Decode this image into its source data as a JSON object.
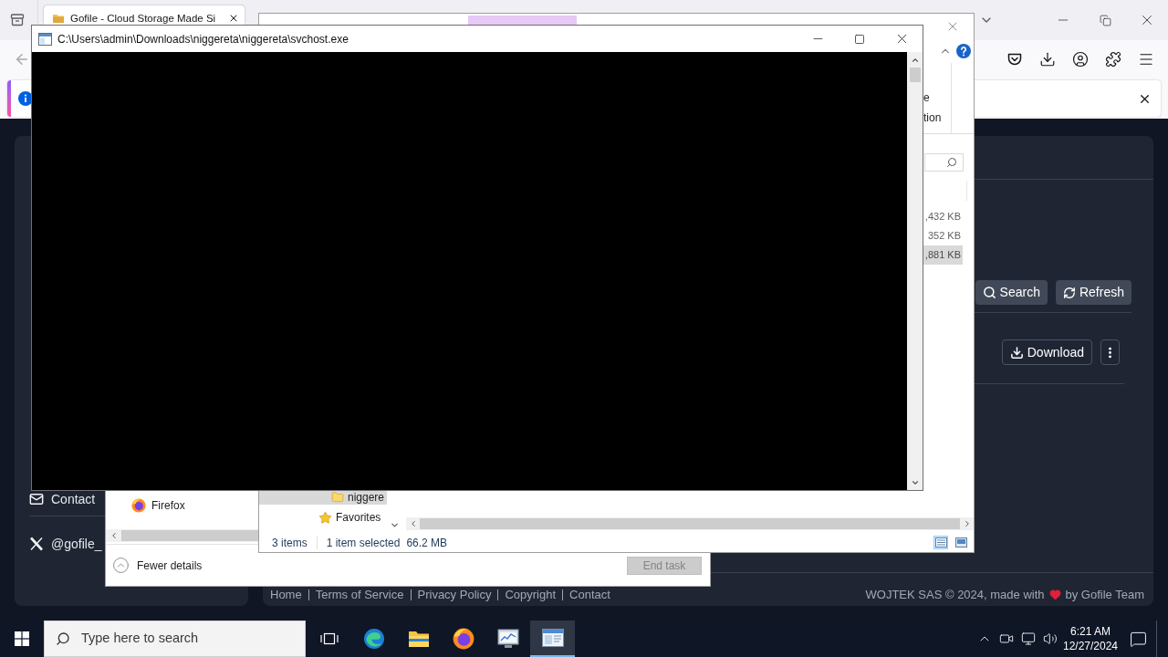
{
  "browser": {
    "tabs": [
      {
        "title": "Gofile - Cloud Storage Made Si",
        "selected": true
      }
    ]
  },
  "console": {
    "title": "C:\\Users\\admin\\Downloads\\niggereta\\niggereta\\svchost.exe"
  },
  "explorer": {
    "ribbon_labels": [
      "e",
      "tion"
    ],
    "sizes": [
      {
        "text": ",432 KB",
        "selected": false
      },
      {
        "text": "352 KB",
        "selected": false
      },
      {
        "text": ",881 KB",
        "selected": true
      }
    ],
    "nav_items": [
      {
        "kind": "folder",
        "label": "niggere",
        "selected": true
      },
      {
        "kind": "favorites",
        "label": "Favorites",
        "selected": false
      }
    ],
    "status": {
      "count": "3 items",
      "selection": "1 item selected",
      "size": "66.2 MB"
    },
    "views": [
      {
        "kind": "details",
        "selected": true
      },
      {
        "kind": "tiles",
        "selected": false
      }
    ]
  },
  "page": {
    "toolbar_buttons": [
      {
        "kind": "search",
        "label": "Search"
      },
      {
        "kind": "refresh",
        "label": "Refresh"
      }
    ],
    "file_actions": [
      {
        "kind": "download",
        "label": "Download"
      },
      {
        "kind": "more"
      }
    ],
    "sidebar_links": [
      {
        "kind": "contact",
        "label": "Contact"
      },
      {
        "kind": "x",
        "label": "@gofile_"
      }
    ],
    "footer_links": [
      "Home",
      "Terms of Service",
      "Privacy Policy",
      "Copyright",
      "Contact"
    ],
    "footer_credit": {
      "before": "WOJTEK SAS © 2024, made with",
      "after": "by Gofile Team"
    }
  },
  "task_manager": {
    "processes": [
      {
        "name": "Firefox"
      }
    ],
    "toggle": "Fewer details",
    "end_task": {
      "label": "End task",
      "disabled": true
    }
  },
  "taskbar": {
    "search": {
      "placeholder": "Type here to search"
    },
    "apps": [
      {
        "kind": "task-view",
        "selected": false
      },
      {
        "kind": "edge",
        "selected": false
      },
      {
        "kind": "explorer",
        "selected": false
      },
      {
        "kind": "firefox",
        "selected": false
      },
      {
        "kind": "task-manager",
        "selected": false
      },
      {
        "kind": "console",
        "selected": true
      }
    ],
    "time": "6:21 AM",
    "date": "12/27/2024"
  }
}
